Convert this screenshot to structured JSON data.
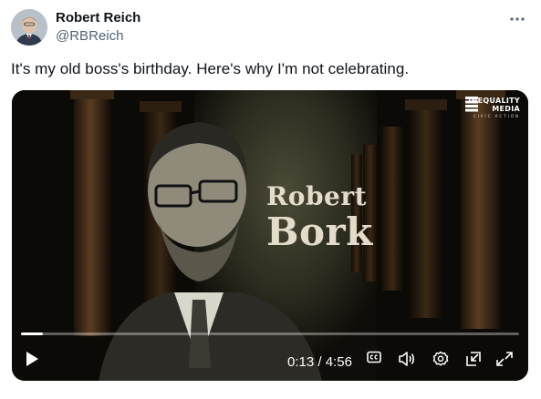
{
  "tweet": {
    "author_name": "Robert Reich",
    "author_handle": "@RBReich",
    "text": "It's my old boss's birthday. Here's why I'm not celebrating."
  },
  "video": {
    "title_line1": "Robert",
    "title_line2": "Bork",
    "brand_line1": "INEQUALITY",
    "brand_line2": "MEDIA",
    "brand_subline": "CIVIC ACTION",
    "current_time": "0:13",
    "separator": " / ",
    "duration": "4:56",
    "progress": 0.044
  },
  "icons": {
    "more": "more-icon",
    "play": "play-icon",
    "captions": "captions-icon",
    "volume": "volume-icon",
    "settings": "settings-icon",
    "pip": "pip-icon",
    "fullscreen": "fullscreen-icon"
  },
  "colors": {
    "text_primary": "#0f1419",
    "text_secondary": "#536471",
    "video_background": "#0b0a07",
    "title_color": "#e4dccb"
  }
}
